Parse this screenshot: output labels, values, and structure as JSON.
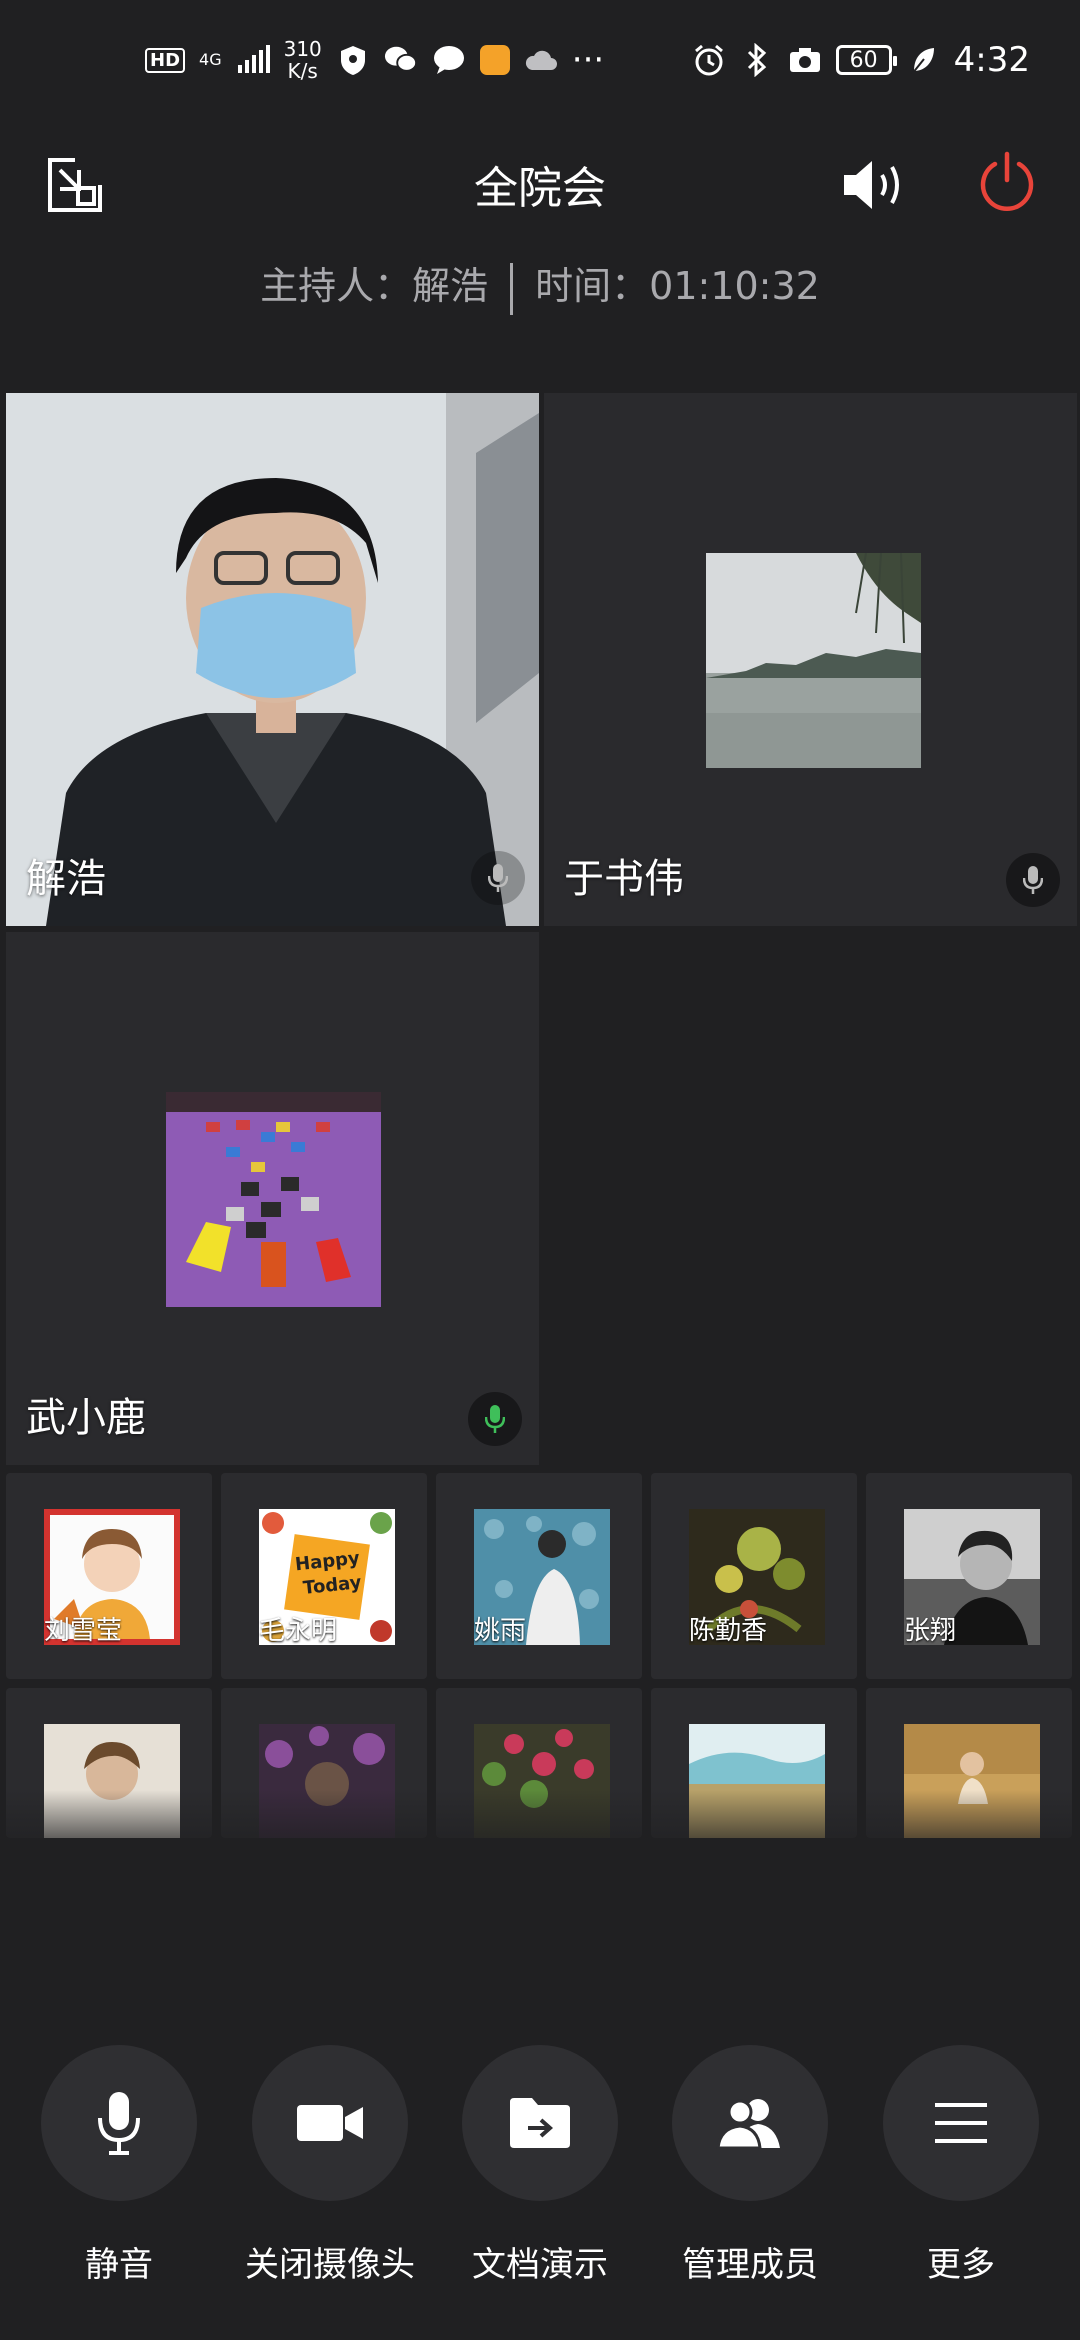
{
  "status_bar": {
    "hd": "HD",
    "network": "4G",
    "speed_top": "310",
    "speed_bottom": "K/s",
    "more": "···",
    "battery": "60",
    "time": "4:32"
  },
  "header": {
    "title": "全院会",
    "host_label": "主持人：解浩",
    "time_label": "时间：01:10:32"
  },
  "video_tiles": [
    {
      "name": "解浩"
    },
    {
      "name": "于书伟"
    },
    {
      "name": "武小鹿"
    }
  ],
  "members_row1": [
    "刘雪莹",
    "毛永明",
    "姚雨",
    "陈勤香",
    "张翔"
  ],
  "members_row2": [
    "",
    "",
    "",
    "",
    ""
  ],
  "avatar_text": {
    "happy": "Happy",
    "today": "Today"
  },
  "toolbar": {
    "mute": "静音",
    "camera_off": "关闭摄像头",
    "doc_present": "文档演示",
    "manage_members": "管理成员",
    "more": "更多"
  },
  "colors": {
    "background": "#202022",
    "power_red": "#e8443a",
    "mic_active_green": "#3fbf5a"
  }
}
